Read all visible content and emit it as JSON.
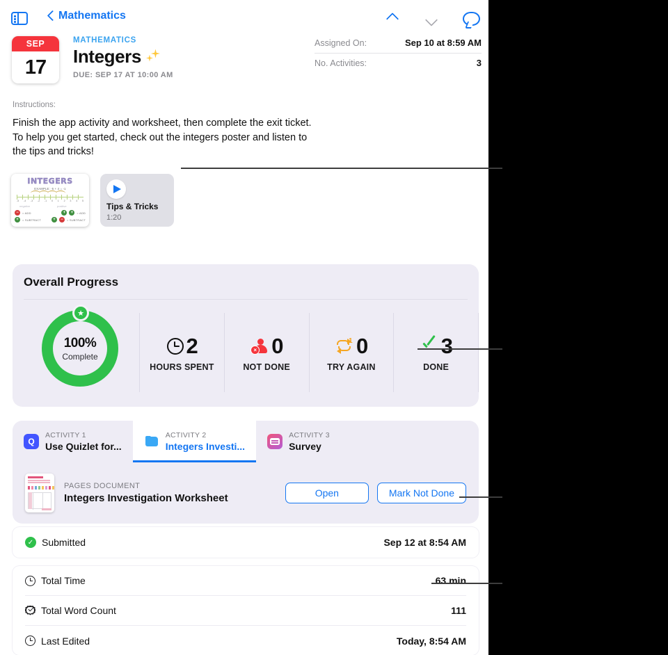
{
  "navbar": {
    "sidebar_toggle_name": "sidebar-toggle-icon",
    "back_label": "Mathematics",
    "chevron_up": "chevron-up-icon",
    "chevron_down": "chevron-down-icon",
    "comment": "comment-bubble-icon"
  },
  "assignment": {
    "calendar_month": "SEP",
    "calendar_day": "17",
    "subject": "MATHEMATICS",
    "title": "Integers",
    "due": "DUE: SEP 17 AT 10:00 AM"
  },
  "meta": {
    "assigned_on_label": "Assigned On:",
    "assigned_on_value": "Sep 10 at 8:59 AM",
    "activities_label": "No. Activities:",
    "activities_value": "3"
  },
  "instructions": {
    "label": "Instructions:",
    "body": "Finish the app activity and worksheet, then complete the exit ticket. To help you get started, check out the integers poster and listen to the tips and tricks!"
  },
  "resources": {
    "poster": {
      "title": "INTEGERS",
      "example": "EXAMPLE: -5 + 4 = -1",
      "left_label": "negative",
      "right_label": "positive",
      "ticks": [
        "-5",
        "-4",
        "-3",
        "-2",
        "-1",
        "0",
        "1",
        "2",
        "3",
        "4",
        "5"
      ],
      "rules": [
        {
          "sign": "−",
          "color": "red",
          "text": "= ADD"
        },
        {
          "sign": "+",
          "color": "green",
          "text": "= SUBTRACT"
        },
        {
          "sign": "+",
          "color": "green",
          "text": "= ADD"
        },
        {
          "sign": "−",
          "color": "red",
          "text": "= SUBTRACT"
        }
      ]
    },
    "video": {
      "title": "Tips & Tricks",
      "duration": "1:20",
      "play_icon": "play-icon"
    }
  },
  "progress": {
    "card_title": "Overall Progress",
    "ring_percent": "100%",
    "ring_sub": "Complete",
    "ring_value": 100,
    "star_badge": "★",
    "stats": [
      {
        "icon": "clock-icon",
        "value": "2",
        "label": "HOURS SPENT"
      },
      {
        "icon": "person-x-icon",
        "value": "0",
        "label": "NOT DONE"
      },
      {
        "icon": "repeat-one-icon",
        "value": "0",
        "label": "TRY AGAIN"
      },
      {
        "icon": "checkmark-icon",
        "value": "3",
        "label": "DONE"
      }
    ]
  },
  "activities": {
    "tabs": [
      {
        "index": "ACTIVITY 1",
        "name": "Use Quizlet for...",
        "icon": "quizlet-app-icon",
        "active": false
      },
      {
        "index": "ACTIVITY 2",
        "name": "Integers Investi...",
        "icon": "folder-app-icon",
        "active": true
      },
      {
        "index": "ACTIVITY 3",
        "name": "Survey",
        "icon": "survey-app-icon",
        "active": false
      }
    ],
    "document": {
      "kind": "PAGES DOCUMENT",
      "name": "Integers Investigation Worksheet",
      "open_button": "Open",
      "mark_button": "Mark Not Done"
    }
  },
  "status": {
    "label": "Submitted",
    "value": "Sep 12 at 8:54 AM",
    "icon": "green-check-icon"
  },
  "details": [
    {
      "icon": "clock-icon",
      "label": "Total Time",
      "value": "63 min"
    },
    {
      "icon": "badge-check-icon",
      "label": "Total Word Count",
      "value": "111"
    },
    {
      "icon": "clock-icon",
      "label": "Last Edited",
      "value": "Today, 8:54 AM"
    }
  ],
  "colors": {
    "accent_blue": "#1476f2",
    "green": "#2fc04b",
    "red": "#f5343c",
    "orange": "#f5a623",
    "card_bg": "#eeecf5"
  }
}
